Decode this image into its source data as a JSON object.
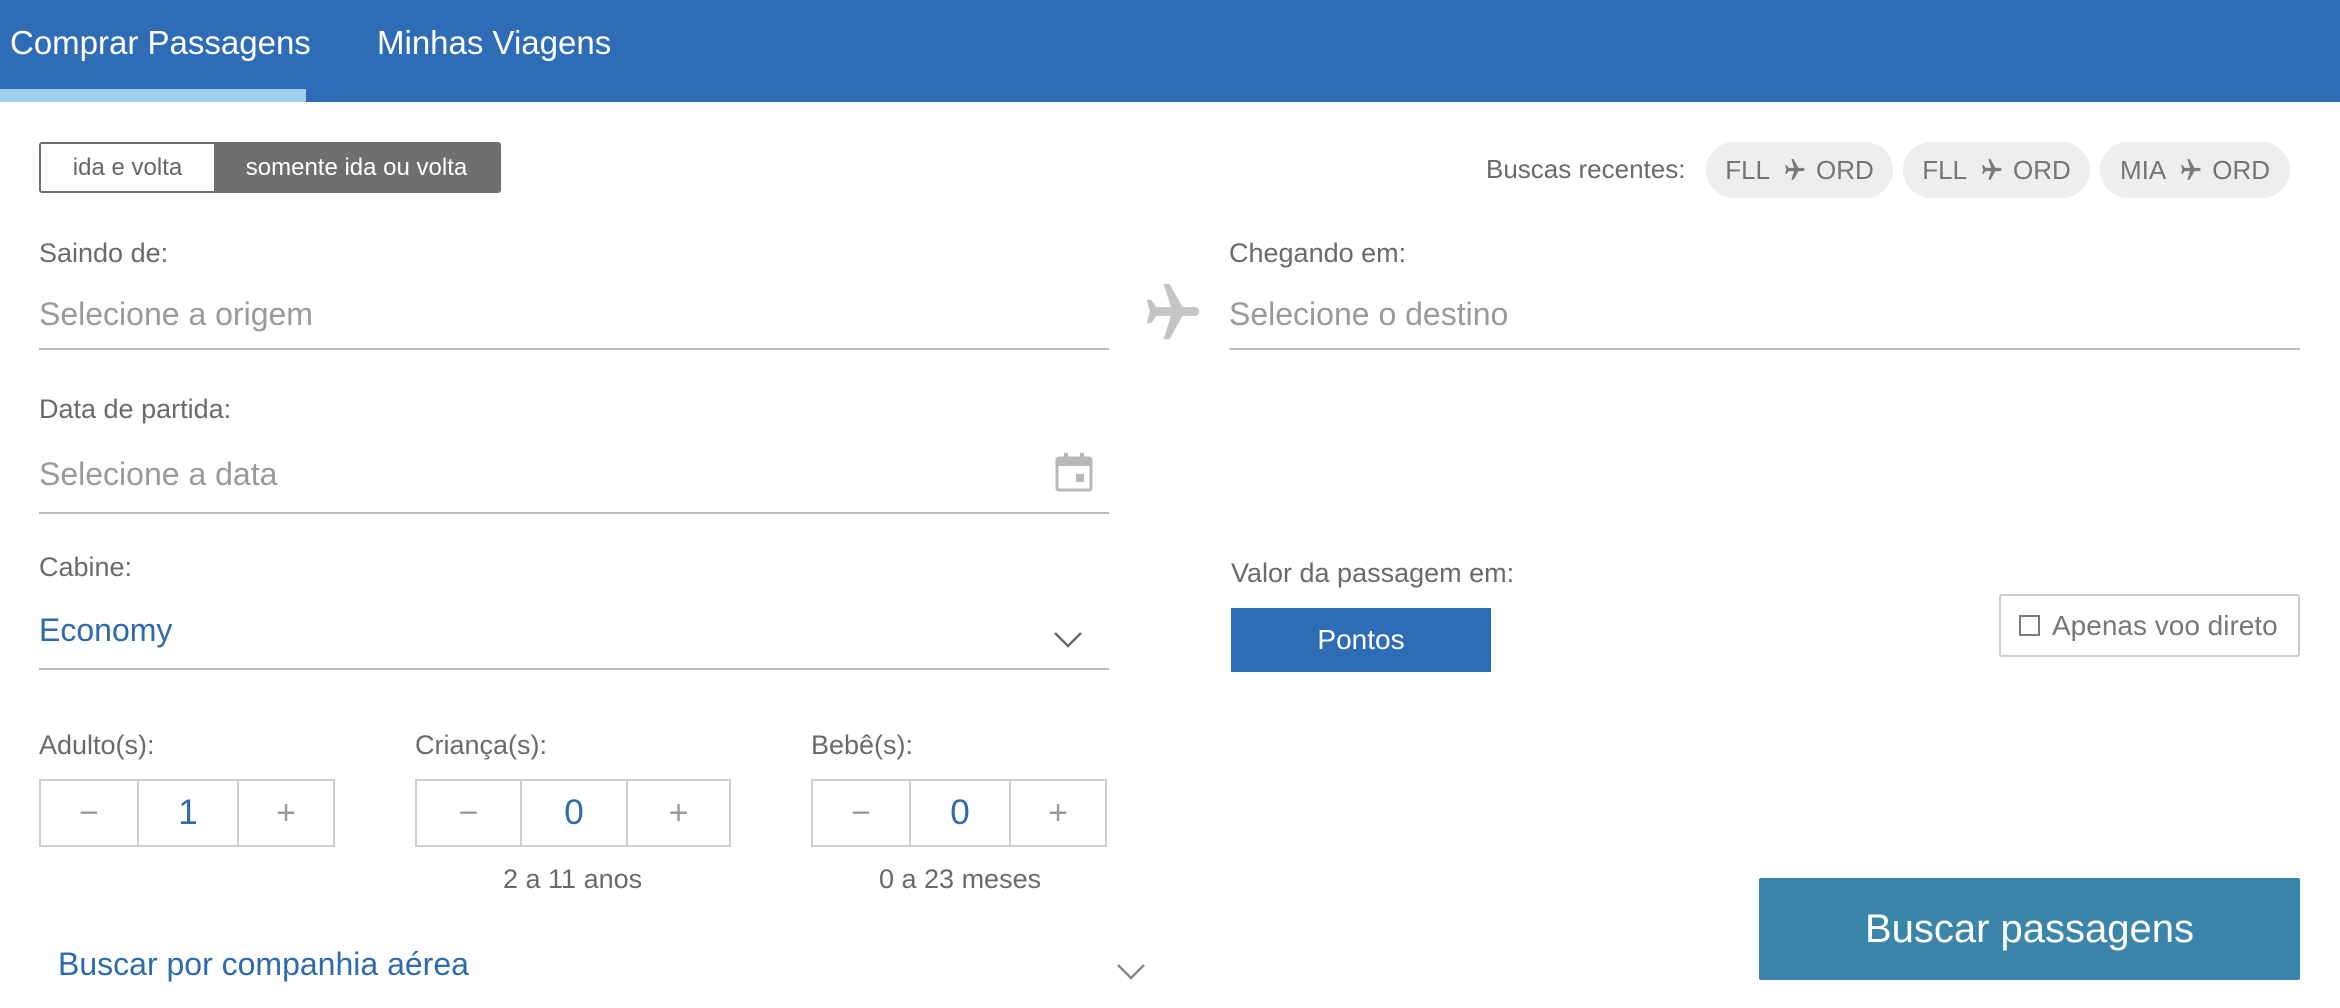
{
  "nav": {
    "tabs": [
      {
        "label": "Comprar Passagens",
        "active": true
      },
      {
        "label": "Minhas Viagens",
        "active": false
      }
    ],
    "active_underline_color": "#9ed0ea",
    "bar_color": "#2e6db5"
  },
  "trip_type": {
    "options": [
      "ida e volta",
      "somente ida ou volta"
    ],
    "selected": "somente ida ou volta"
  },
  "recent_searches": {
    "label": "Buscas recentes:",
    "items": [
      {
        "from": "FLL",
        "to": "ORD"
      },
      {
        "from": "FLL",
        "to": "ORD"
      },
      {
        "from": "MIA",
        "to": "ORD"
      }
    ]
  },
  "origin": {
    "label": "Saindo de:",
    "placeholder": "Selecione a origem",
    "value": ""
  },
  "destination": {
    "label": "Chegando em:",
    "placeholder": "Selecione o destino",
    "value": ""
  },
  "departure_date": {
    "label": "Data de partida:",
    "placeholder": "Selecione a data",
    "value": ""
  },
  "cabin": {
    "label": "Cabine:",
    "selected": "Economy"
  },
  "price_type": {
    "label": "Valor da passagem em:",
    "selected": "Pontos"
  },
  "direct_flight": {
    "label": "Apenas voo direto",
    "checked": false
  },
  "passengers": {
    "adults": {
      "label": "Adulto(s):",
      "count": "1",
      "minus": "−",
      "plus": "+"
    },
    "children": {
      "label": "Criança(s):",
      "count": "0",
      "minus": "−",
      "plus": "+",
      "hint": "2 a 11 anos"
    },
    "infants": {
      "label": "Bebê(s):",
      "count": "0",
      "minus": "−",
      "plus": "+",
      "hint": "0 a 23 meses"
    }
  },
  "search_button": {
    "label": "Buscar passagens",
    "color": "#3c85aa"
  },
  "airline_search": {
    "label": "Buscar por companhia aérea"
  },
  "icons": {
    "plane": "plane-icon",
    "calendar": "calendar-icon",
    "chevron": "chevron-down-icon"
  }
}
